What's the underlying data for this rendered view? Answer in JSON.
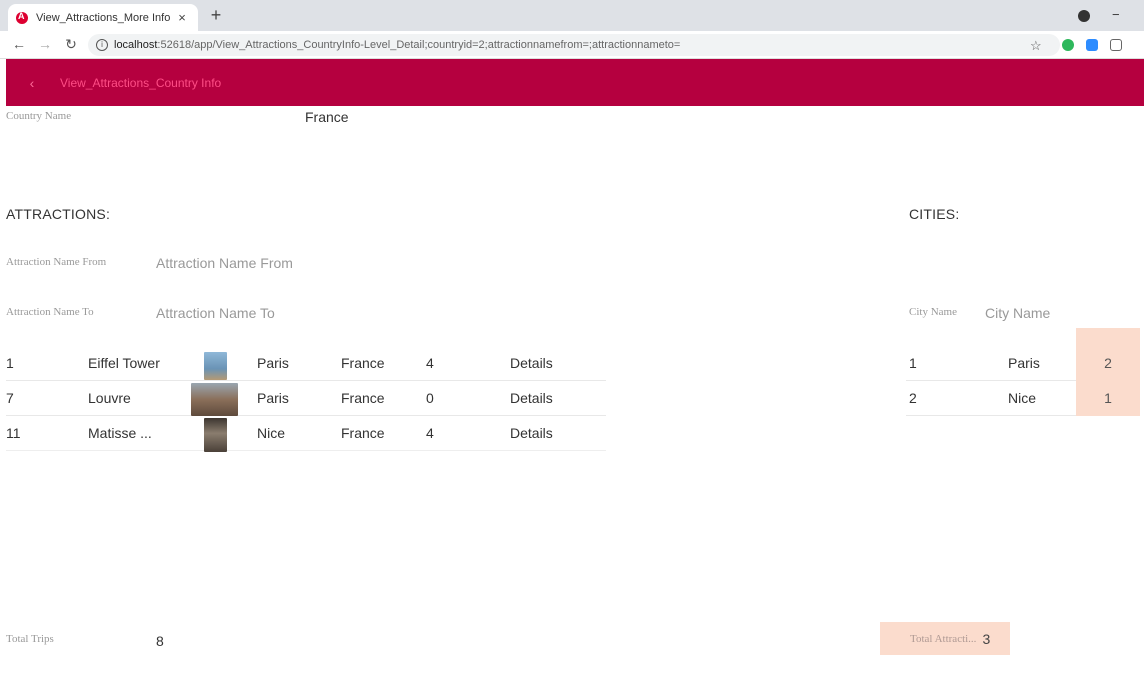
{
  "browser": {
    "tab_title": "View_Attractions_More Info",
    "tab_close": "×",
    "new_tab": "+",
    "minimize": "−",
    "url_host": "localhost",
    "url_path": ":52618/app/View_Attractions_CountryInfo-Level_Detail;countryid=2;attractionnamefrom=;attractionnameto="
  },
  "header": {
    "back_icon": "‹",
    "title": "View_Attractions_Country Info"
  },
  "country": {
    "label": "Country Name",
    "value": "France"
  },
  "attractions": {
    "section_title": "ATTRACTIONS:",
    "from_label": "Attraction Name From",
    "from_placeholder": "Attraction Name From",
    "to_label": "Attraction Name To",
    "to_placeholder": "Attraction Name To",
    "rows": [
      {
        "id": "1",
        "name": "Eiffel Tower",
        "thumb_color": "#7aa6c9",
        "city": "Paris",
        "country": "France",
        "trips": "4",
        "action": "Details"
      },
      {
        "id": "7",
        "name": "Louvre",
        "thumb_color": "#8a6f5a",
        "city": "Paris",
        "country": "France",
        "trips": "0",
        "action": "Details"
      },
      {
        "id": "11",
        "name": "Matisse ...",
        "thumb_color": "#5a5048",
        "city": "Nice",
        "country": "France",
        "trips": "4",
        "action": "Details"
      }
    ]
  },
  "cities": {
    "section_title": "CITIES:",
    "name_label": "City Name",
    "name_placeholder": "City Name",
    "rows": [
      {
        "id": "1",
        "name": "Paris",
        "count": "2"
      },
      {
        "id": "2",
        "name": "Nice",
        "count": "1"
      }
    ]
  },
  "totals": {
    "trips_label": "Total Trips",
    "trips_value": "8",
    "attractions_label": "Total Attracti...",
    "attractions_value": "3"
  }
}
